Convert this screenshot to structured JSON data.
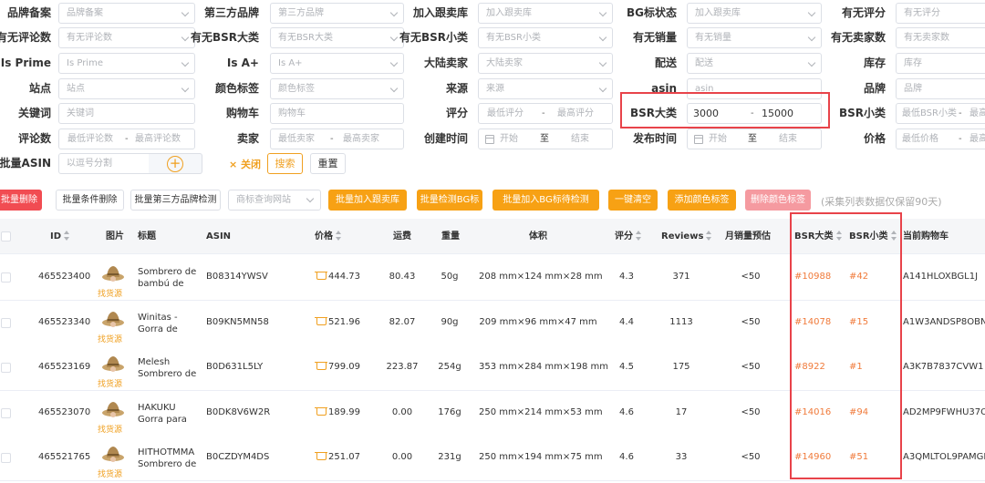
{
  "filters": {
    "brand_filing": {
      "label": "品牌备案",
      "placeholder": "品牌备案"
    },
    "third_party_brand": {
      "label": "第三方品牌",
      "placeholder": "第三方品牌"
    },
    "add_to_tracking": {
      "label": "加入跟卖库",
      "placeholder": "加入跟卖库"
    },
    "bg_status": {
      "label": "BG标状态",
      "placeholder": "加入跟卖库"
    },
    "has_rating": {
      "label": "有无评分",
      "placeholder": "有无评分"
    },
    "has_reviews": {
      "label": "有无评论数",
      "placeholder": "有无评论数"
    },
    "has_bsr_main": {
      "label": "有无BSR大类",
      "placeholder": "有无BSR大类"
    },
    "has_bsr_sub": {
      "label": "有无BSR小类",
      "placeholder": "有无BSR小类"
    },
    "has_sales": {
      "label": "有无销量",
      "placeholder": "有无销量"
    },
    "has_seller_count": {
      "label": "有无卖家数",
      "placeholder": "有无卖家数"
    },
    "is_prime": {
      "label": "Is Prime",
      "placeholder": "Is Prime"
    },
    "is_a_plus": {
      "label": "Is A+",
      "placeholder": "Is A+"
    },
    "mainland_seller": {
      "label": "大陆卖家",
      "placeholder": "大陆卖家"
    },
    "delivery": {
      "label": "配送",
      "placeholder": "配送"
    },
    "stock": {
      "label": "库存",
      "placeholder": "库存"
    },
    "site": {
      "label": "站点",
      "placeholder": "站点"
    },
    "color_tag": {
      "label": "颜色标签",
      "placeholder": "颜色标签"
    },
    "source": {
      "label": "来源",
      "placeholder": "来源"
    },
    "asin": {
      "label": "asin",
      "placeholder": "asin"
    },
    "brand": {
      "label": "品牌",
      "placeholder": "品牌"
    },
    "keyword": {
      "label": "关键词",
      "placeholder": "关键词"
    },
    "buybox": {
      "label": "购物车",
      "placeholder": "购物车"
    },
    "rating": {
      "label": "评分",
      "min_placeholder": "最低评分",
      "max_placeholder": "最高评分"
    },
    "bsr_main": {
      "label": "BSR大类",
      "min_value": "3000",
      "max_value": "15000"
    },
    "bsr_sub": {
      "label": "BSR小类",
      "min_placeholder": "最低BSR小类",
      "max_placeholder": "最高"
    },
    "review_count": {
      "label": "评论数",
      "min_placeholder": "最低评论数",
      "max_placeholder": "最高评论数"
    },
    "seller": {
      "label": "卖家",
      "min_placeholder": "最低卖家",
      "max_placeholder": "最高卖家"
    },
    "created_time": {
      "label": "创建时间",
      "start": "开始",
      "to": "至",
      "end": "结束"
    },
    "publish_time": {
      "label": "发布时间",
      "start": "开始",
      "to": "至",
      "end": "结束"
    },
    "price": {
      "label": "价格",
      "min_placeholder": "最低价格",
      "max_placeholder": "最高"
    },
    "bulk_asin": {
      "label": "批量ASIN",
      "placeholder": "以逗号分割",
      "plus": "+"
    },
    "range_dash": "-",
    "close_label": "× 关闭",
    "search_label": "搜索",
    "reset_label": "重置"
  },
  "actions": {
    "bulk_delete": "批量删除",
    "bulk_condition_delete": "批量条件删除",
    "bulk_third_party_check": "批量第三方品牌检测",
    "trademark_site_placeholder": "商标查询网站",
    "bulk_add_tracking": "批量加入跟卖库",
    "bulk_bg_check": "批量检测BG标",
    "bulk_add_bg_check": "批量加入BG标待检测",
    "one_click_clear": "一键清空",
    "add_color_tag": "添加颜色标签",
    "delete_color_tag": "删除颜色标签",
    "retention_note": "(采集列表数据仅保留90天)"
  },
  "table": {
    "headers": {
      "id": "ID",
      "image": "图片",
      "title": "标题",
      "asin": "ASIN",
      "price": "价格",
      "shipping": "运费",
      "weight": "重量",
      "volume": "体积",
      "rating": "评分",
      "reviews": "Reviews",
      "monthly_sales": "月销量预估",
      "bsr_main": "BSR大类",
      "bsr_sub": "BSR小类",
      "current_buybox": "当前购物车"
    },
    "find_source": "找货源",
    "rows": [
      {
        "id": "465523400",
        "title": "Sombrero de bambú de mod...",
        "asin": "B08314YWSV",
        "price": "444.73",
        "shipping": "80.43",
        "weight": "50g",
        "volume": "208 mm×124 mm×28 mm",
        "rating": "4.3",
        "reviews": "371",
        "monthly_sales": "<50",
        "bsr_main": "#10988",
        "bsr_sub": "#42",
        "buybox": "A141HLOXBGL1J"
      },
      {
        "id": "465523340",
        "title": "Winitas - Gorra de béisbol su...",
        "asin": "B09KN5MN58",
        "price": "521.96",
        "shipping": "82.07",
        "weight": "90g",
        "volume": "209 mm×96 mm×47 mm",
        "rating": "4.4",
        "reviews": "1113",
        "monthly_sales": "<50",
        "bsr_main": "#14078",
        "bsr_sub": "#15",
        "buybox": "A1W3ANDSP8OBNJ"
      },
      {
        "id": "465523169",
        "title": "Melesh Sombrero de vaquero...",
        "asin": "B0D631L5LY",
        "price": "799.09",
        "shipping": "223.87",
        "weight": "254g",
        "volume": "353 mm×284 mm×198 mm",
        "rating": "4.5",
        "reviews": "175",
        "monthly_sales": "<50",
        "bsr_main": "#8922",
        "bsr_sub": "#1",
        "buybox": "A3K7B7837CVW1"
      },
      {
        "id": "465523070",
        "title": "HAKUKU Gorra para Frio para...",
        "asin": "B0DK8V6W2R",
        "price": "189.99",
        "shipping": "0.00",
        "weight": "176g",
        "volume": "250 mm×214 mm×53 mm",
        "rating": "4.6",
        "reviews": "17",
        "monthly_sales": "<50",
        "bsr_main": "#14016",
        "bsr_sub": "#94",
        "buybox": "AD2MP9FWHU37O"
      },
      {
        "id": "465521765",
        "title": "HITHOTMMA Sombrero de S...",
        "asin": "B0CZDYM4DS",
        "price": "251.07",
        "shipping": "0.00",
        "weight": "231g",
        "volume": "250 mm×194 mm×75 mm",
        "rating": "4.6",
        "reviews": "33",
        "monthly_sales": "<50",
        "bsr_main": "#14960",
        "bsr_sub": "#51",
        "buybox": "A3QMLTOL9PAMGI"
      }
    ]
  },
  "colors": {
    "accent": "#f7a114",
    "danger": "#f14c52",
    "bsr_text": "#f07a3a",
    "highlight": "#e8434a"
  },
  "icons": [
    "chevron-down-icon",
    "calendar-icon",
    "plus-circle-icon",
    "sort-icon",
    "cart-price-icon",
    "checkbox-icon",
    "hat-thumbnail"
  ]
}
